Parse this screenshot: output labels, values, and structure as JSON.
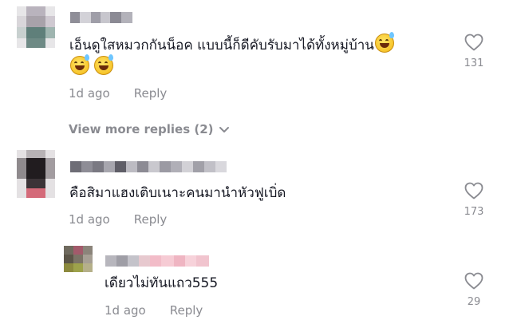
{
  "comments": [
    {
      "text": "เอ็นดูใสหมวกกันน็อค แบบนี้ก็ดีคับรับมาได้ทั้งหมู่บ้าน",
      "emoji": "grinning-sweat-emoji",
      "time": "1d ago",
      "reply_label": "Reply",
      "likes": "131"
    },
    {
      "text": "คือสิมาแฮงเติบเนาะคนมานำหัวฟูเบิ่ด",
      "time": "1d ago",
      "reply_label": "Reply",
      "likes": "173"
    }
  ],
  "view_more": "View more replies (2)",
  "reply": {
    "text": "เดียวไม่ทันแถว555",
    "time": "1d ago",
    "reply_label": "Reply",
    "likes": "29"
  },
  "colors": {
    "text": "#161823",
    "muted": "#8a8b91",
    "background": "#ffffff"
  },
  "icons": [
    "heart-outline-icon",
    "chevron-down-icon"
  ]
}
